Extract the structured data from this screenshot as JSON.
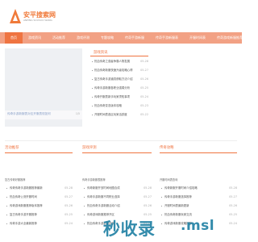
{
  "brand": {
    "title": "安平搜索网",
    "subtitle": "ANPING SOUSUO WANG",
    "accent": "#ef7441"
  },
  "nav": [
    {
      "label": "首页",
      "active": true
    },
    {
      "label": "游戏资讯"
    },
    {
      "label": "活动推荐"
    },
    {
      "label": "游戏评测"
    },
    {
      "label": "专题攻略"
    },
    {
      "label": "传奇手游新服"
    },
    {
      "label": "传奇手游新服表"
    },
    {
      "label": "开服时间表"
    },
    {
      "label": "传奇游戏新服推荐"
    }
  ],
  "hero": {
    "caption": "传奇手游新服表对应开服表现如何",
    "count": "1/5"
  },
  "news": {
    "title": "游戏资讯",
    "items": [
      {
        "title": "热血传奇之强者争霸人物发展",
        "date": "05-28"
      },
      {
        "title": "热血传奇新服快速升级攻略心得",
        "date": "05-27"
      },
      {
        "title": "复古传奇手游道具获取方法介绍",
        "date": "05-26"
      },
      {
        "title": "传奇手游新服各职业强弱分析",
        "date": "05-25"
      },
      {
        "title": "传奇开服表新手玩家须知事项",
        "date": "05-24"
      },
      {
        "title": "热血传奇变态版本攻略",
        "date": "05-23"
      },
      {
        "title": "开服时间表各区玩家活跃度",
        "date": "05-22"
      }
    ]
  },
  "cols": {
    "activity": {
      "title": "活动推荐",
      "lead": "复古传奇好服推荐",
      "items": [
        {
          "title": "传奇传奇手游新服推荐最新",
          "date": "05-28"
        },
        {
          "title": "热血传奇公测开服时间",
          "date": "05-27"
        },
        {
          "title": "传奇游戏新服推荐版本推荐",
          "date": "05-26"
        },
        {
          "title": "复古传奇手游开服推荐",
          "date": "05-25"
        },
        {
          "title": "传奇手游大全最新推荐",
          "date": "05-24"
        }
      ]
    },
    "review": {
      "title": "游戏评测",
      "lead": "传奇手游新服表推荐",
      "items": [
        {
          "title": "传奇新服开放时间地图合成",
          "date": "05-28"
        },
        {
          "title": "传奇手游新服不同职业选择",
          "date": "05-27"
        },
        {
          "title": "热血传奇手游新服活动介绍",
          "date": "05-26"
        },
        {
          "title": "传奇游戏新服推荐开区",
          "date": "05-25"
        },
        {
          "title": "热血传奇手游新服选择",
          "date": "05-24"
        }
      ]
    },
    "topics": {
      "title": "传奇攻略",
      "lead": "开服时间表查询",
      "items": [
        {
          "title": "传奇新服开服时间介绍攻略",
          "date": "05-28"
        },
        {
          "title": "传奇手游新服选择推荐",
          "date": "05-27"
        },
        {
          "title": "开服时间表最新更新",
          "date": "05-26"
        },
        {
          "title": "热血传奇新服玩家交流",
          "date": "05-25"
        },
        {
          "title": "传奇游戏新服攻略推荐",
          "date": "05-24"
        }
      ]
    }
  },
  "watermark": {
    "text": "秒收录",
    "domain": ".msl"
  }
}
